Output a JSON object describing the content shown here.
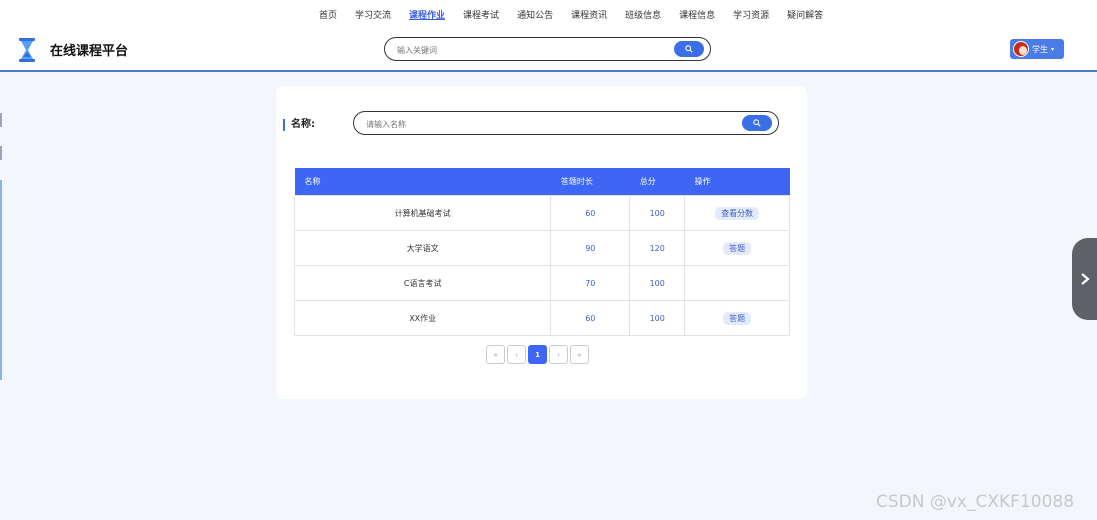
{
  "nav": {
    "items": [
      "首页",
      "学习交流",
      "课程作业",
      "课程考试",
      "通知公告",
      "课程资讯",
      "班级信息",
      "课程信息",
      "学习资源",
      "疑问解答"
    ],
    "active_index": 2
  },
  "header": {
    "title": "在线课程平台",
    "search_placeholder": "输入关键词",
    "user_label": "学生",
    "user_caret": "▾"
  },
  "filter": {
    "label": "名称:",
    "placeholder": "请输入名称"
  },
  "table": {
    "headers": [
      "名称",
      "答题时长",
      "总分",
      "操作"
    ],
    "rows": [
      {
        "name": "计算机基础考试",
        "duration": "60",
        "score": "100",
        "action": "查看分数"
      },
      {
        "name": "大学语文",
        "duration": "90",
        "score": "120",
        "action": "答题"
      },
      {
        "name": "C语言考试",
        "duration": "70",
        "score": "100",
        "action": ""
      },
      {
        "name": "XX作业",
        "duration": "60",
        "score": "100",
        "action": "答题"
      }
    ]
  },
  "pagination": {
    "first": "«",
    "prev": "‹",
    "current": "1",
    "next": "›",
    "last": "»"
  },
  "watermark": "CSDN @vx_CXKF10088",
  "icons": {
    "logo": "hourglass-icon",
    "search": "search-icon",
    "side_handle": "chevron-right-icon"
  },
  "colors": {
    "accent": "#3d66f5",
    "page_bg": "#f3f7fd",
    "tag_bg": "#e3eaf9"
  }
}
